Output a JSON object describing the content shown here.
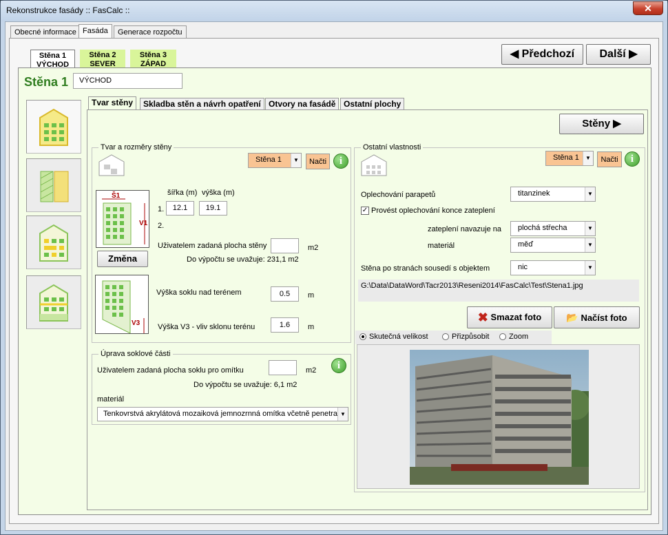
{
  "window": {
    "title": "Rekonstrukce fasády :: FasCalc ::",
    "close": "✕"
  },
  "main_tabs": [
    "Obecné informace",
    "Fasáda",
    "Generace rozpočtu"
  ],
  "wall_tabs": [
    {
      "line1": "Stěna 1",
      "line2": "VÝCHOD"
    },
    {
      "line1": "Stěna 2",
      "line2": "SEVER"
    },
    {
      "line1": "Stěna 3",
      "line2": "ZÁPAD"
    }
  ],
  "nav": {
    "prev": "Předchozí",
    "next": "Další"
  },
  "wall": {
    "heading": "Stěna 1",
    "name": "VÝCHOD"
  },
  "inner_tabs": [
    "Tvar stěny",
    "Skladba stěn a návrh opatření",
    "Otvory na fasádě",
    "Ostatní plochy"
  ],
  "walls_button": "Stěny",
  "shape": {
    "group_title": "Tvar a rozměry stěny",
    "wall_select": "Stěna 1",
    "load": "Načti",
    "width_label": "šířka (m)",
    "height_label": "výška (m)",
    "row1": "1.",
    "row2": "2.",
    "width1": "12.1",
    "height1": "19.1",
    "s1": "Š1",
    "v1": "V1",
    "v3": "V3",
    "change": "Změna",
    "user_area_label": "Uživatelem zadaná plocha stěny",
    "user_area_value": "",
    "user_area_unit": "m2",
    "calc_label": "Do výpočtu se uvažuje: 231,1 m2",
    "plinth_label": "Výška soklu nad terénem",
    "plinth_value": "0.5",
    "plinth_unit": "m",
    "slope_label": "Výška V3 - vliv sklonu terénu",
    "slope_value": "1.6",
    "slope_unit": "m"
  },
  "plinth": {
    "group_title": "Úprava soklové části",
    "user_area_label": "Uživatelem zadaná plocha soklu pro omítku",
    "user_area_value": "",
    "unit": "m2",
    "calc_label": "Do výpočtu se uvažuje: 6,1 m2",
    "material_label": "materiál",
    "material_value": "Tenkovrstvá akrylátová mozaiková jemnozrnná omítka včetně penetra"
  },
  "other": {
    "group_title": "Ostatní vlastnosti",
    "wall_select": "Stěna 1",
    "load": "Načti",
    "sill_label": "Oplechování parapetů",
    "sill_value": "titanzinek",
    "edge_check_label": "Provést oplechování konce zateplení",
    "edge_checked": true,
    "insulation_label": "zateplení navazuje na",
    "insulation_value": "plochá střecha",
    "material_label": "materiál",
    "material_value": "měď",
    "neighbor_label": "Stěna po stranách sousedí s objektem",
    "neighbor_value": "nic",
    "photo_path": "G:\\Data\\DataWord\\Tacr2013\\Reseni2014\\FasCalc\\Test\\Stena1.jpg",
    "delete_photo": "Smazat foto",
    "load_photo": "Načíst foto",
    "radio_actual": "Skutečná velikost",
    "radio_fit": "Přizpůsobit",
    "radio_zoom": "Zoom",
    "selected_radio": "Skutečná velikost"
  },
  "colors": {
    "accent_green": "#2f7d1f",
    "orange": "#f9c493",
    "wall_tab_green": "#d9f59a",
    "panel_bg": "#f4fde7"
  },
  "icons": [
    "building-icon",
    "insulation-icon",
    "openings-icon",
    "other-surfaces-icon",
    "wall-shape-icon",
    "wall-slope-icon",
    "info-icon",
    "delete-icon",
    "folder-icon"
  ]
}
